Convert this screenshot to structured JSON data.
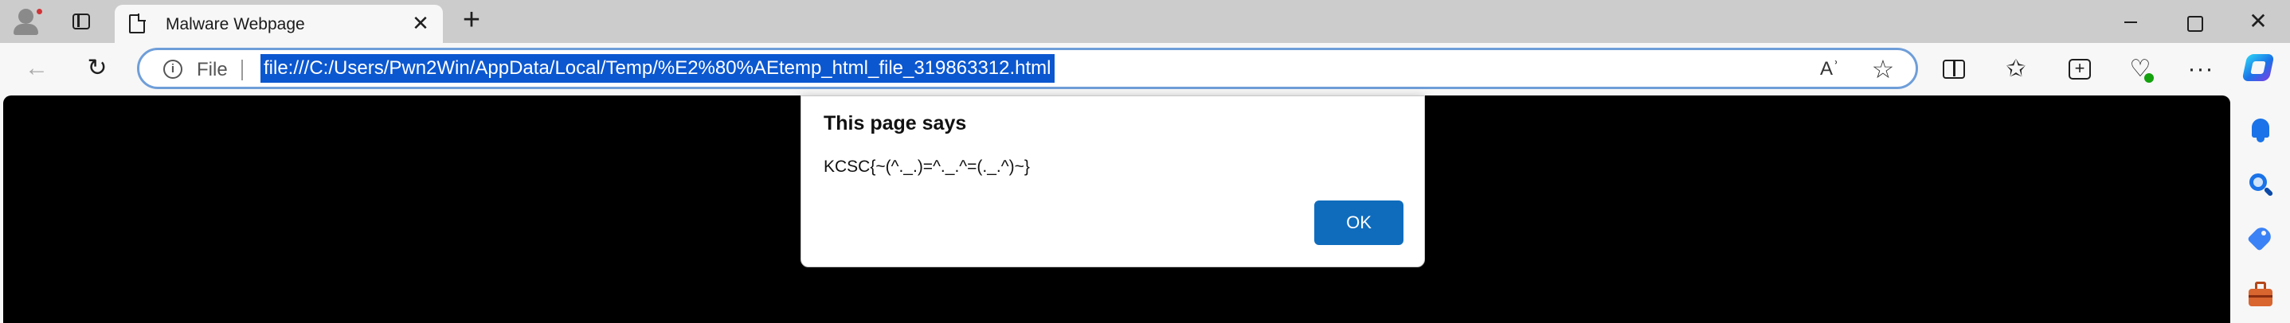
{
  "tab": {
    "title": "Malware Webpage",
    "close_glyph": "✕",
    "new_tab_glyph": "+"
  },
  "window_controls": {
    "close_glyph": "✕"
  },
  "toolbar": {
    "back_glyph": "←",
    "reload_glyph": "↻",
    "address": {
      "info_glyph": "i",
      "scheme_label": "File",
      "url": "file:///C:/Users/Pwn2Win/AppData/Local/Temp/%E2%80%AEtemp_html_file_319863312.html",
      "read_aloud_glyph": "Aʾ",
      "favorite_glyph": "☆"
    },
    "favorites_glyph": "✩",
    "health_glyph": "♡",
    "more_glyph": "···"
  },
  "dialog": {
    "heading": "This page says",
    "message": "KCSC{~(^._.)=^._.^=(._.^)~}",
    "ok_label": "OK"
  },
  "colors": {
    "accent": "#0f6cbd",
    "url_selection": "#0b57d0",
    "page_background": "#000000"
  }
}
